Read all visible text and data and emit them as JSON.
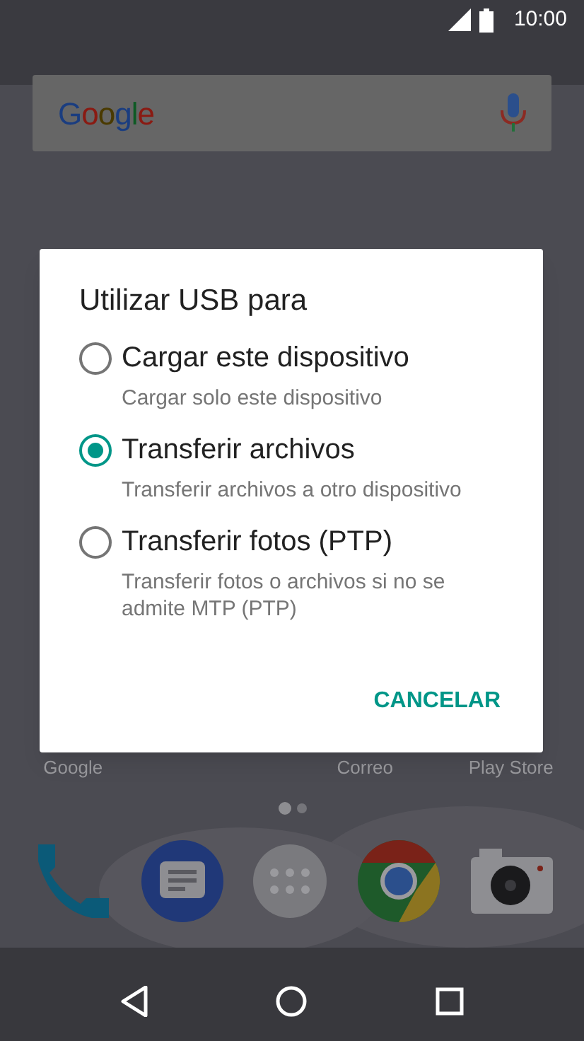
{
  "status_bar": {
    "time": "10:00"
  },
  "search_bar": {
    "logo": "Google"
  },
  "dialog": {
    "title": "Utilizar USB para",
    "options": [
      {
        "label": "Cargar este dispositivo",
        "description": "Cargar solo este dispositivo",
        "selected": false
      },
      {
        "label": "Transferir archivos",
        "description": "Transferir archivos a otro dispositivo",
        "selected": true
      },
      {
        "label": "Transferir fotos (PTP)",
        "description": "Transferir fotos o archivos si no se admite MTP (PTP)",
        "selected": false
      }
    ],
    "buttons": [
      "CANCELAR"
    ]
  },
  "home_shortcuts": [
    {
      "label": "Google"
    },
    {
      "label": "Correo"
    },
    {
      "label": "Play Store"
    }
  ],
  "page_dots": [
    {
      "selected": true
    },
    {
      "selected": false
    }
  ]
}
